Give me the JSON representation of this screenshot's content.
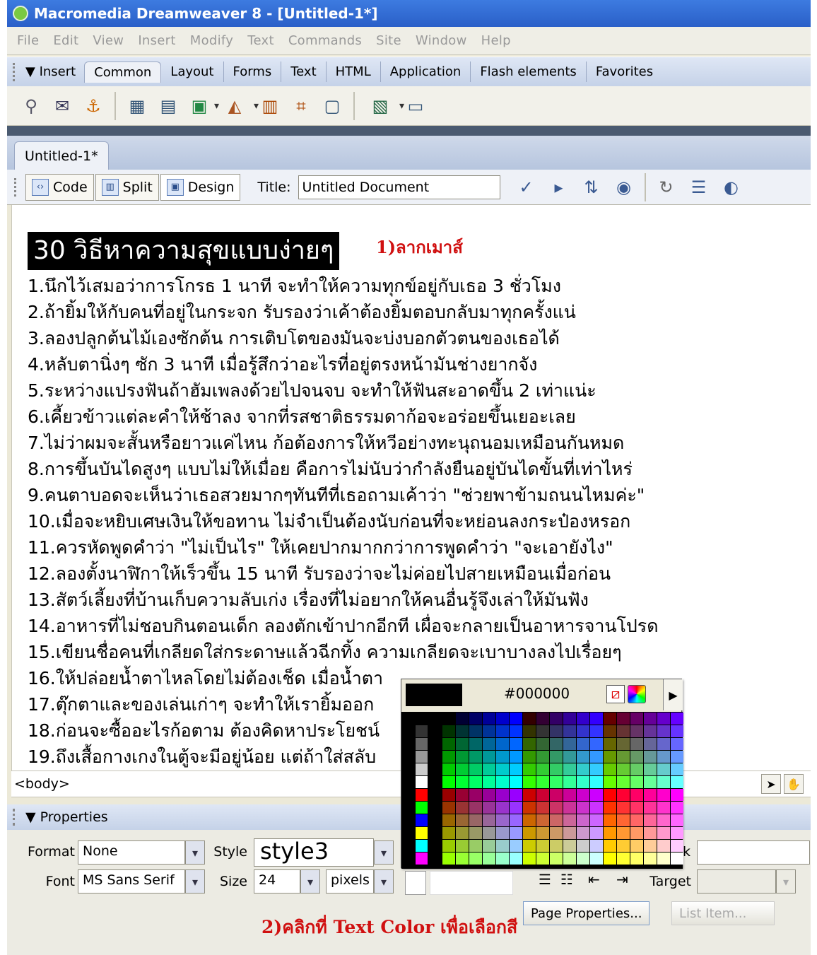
{
  "window": {
    "title": "Macromedia Dreamweaver 8 - [Untitled-1*]"
  },
  "menu": [
    "File",
    "Edit",
    "View",
    "Insert",
    "Modify",
    "Text",
    "Commands",
    "Site",
    "Window",
    "Help"
  ],
  "insert_bar": {
    "label": "Insert",
    "tabs": [
      "Common",
      "Layout",
      "Forms",
      "Text",
      "HTML",
      "Application",
      "Flash elements",
      "Favorites"
    ],
    "active_tab": "Common",
    "icons": [
      "hyperlink-icon",
      "email-link-icon",
      "named-anchor-icon",
      "table-icon",
      "div-icon",
      "image-icon",
      "media-icon",
      "date-icon",
      "server-side-include-icon",
      "comment-icon",
      "template-icon",
      "tag-chooser-icon"
    ]
  },
  "document": {
    "tab_label": "Untitled-1*",
    "view_buttons": {
      "code": "Code",
      "split": "Split",
      "design": "Design"
    },
    "title_label": "Title:",
    "title_value": "Untitled Document",
    "heading": "30 วิธีหาความสุขแบบง่ายๆ",
    "annotation_drag": "1)ลากเมาส์",
    "lines": [
      "1.นึกไว้เสมอว่าการโกรธ 1 นาที จะทำให้ความทุกข์อยู่กับเธอ 3 ชั่วโมง",
      "2.ถ้ายิ้มให้กับคนที่อยู่ในกระจก รับรองว่าเค้าต้องยิ้มตอบกลับมาทุกครั้งแน่",
      "3.ลองปลูกต้นไม้เองซักต้น การเติบโตของมันจะบ่งบอกตัวตนของเธอได้",
      "4.หลับตานิ่งๆ ซัก 3 นาที เมื่อรู้สึกว่าอะไรที่อยู่ตรงหน้ามันช่างยากจัง",
      "5.ระหว่างแปรงฟันถ้าฮัมเพลงด้วยไปจนจบ จะทำให้ฟันสะอาดขึ้น 2 เท่าแน่ะ",
      "6.เคี้ยวข้าวแต่ละคำให้ช้าลง จากที่รสชาติธรรมดาก้อจะอร่อยขึ้นเยอะเลย",
      "7.ไม่ว่าผมจะสั้นหรือยาวแค่ไหน ก้อต้องการให้หวีอย่างทะนุถนอมเหมือนกันหมด",
      "8.การขึ้นบันไดสูงๆ แบบไม่ให้เมื่อย คือการไม่นับว่ากำลังยืนอยู่บันไดขั้นที่เท่าไหร่",
      "9.คนตาบอดจะเห็นว่าเธอสวยมากๆทันทีที่เธอถามเค้าว่า \"ช่วยพาข้ามถนนไหมค่ะ\"",
      "10.เมื่อจะหยิบเศษเงินให้ขอทาน ไม่จำเป็นต้องนับก่อนที่จะหย่อนลงกระป๋องหรอก",
      "11.ควรหัดพูดคำว่า \"ไม่เป็นไร\" ให้เคยปากมากกว่าการพูดคำว่า \"จะเอายังไง\"",
      "12.ลองตั้งนาฬิกาให้เร็วขึ้น 15 นาที รับรองว่าจะไม่ค่อยไปสายเหมือนเมื่อก่อน",
      "13.สัตว์เลี้ยงที่บ้านเก็บความลับเก่ง เรื่องที่ไม่อยากให้คนอื่นรู้จึงเล่าให้มันฟัง",
      "14.อาหารที่ไม่ชอบกินตอนเด็ก ลองตักเข้าปากอีกที เผื่อจะกลายเป็นอาหารจานโปรด",
      "15.เขียนชื่อคนที่เกลียดใส่กระดาษแล้วฉีกทิ้ง ความเกลียดจะเบาบางลงไปเรื่อยๆ",
      "16.ให้ปล่อยน้ำตาไหลโดยไม่ต้องเช็ด เมื่อน้ำตา",
      "17.ตุ๊กตาและของเล่นเก่าๆ จะทำให้เรายิ้มออก",
      "18.ก่อนจะซื้ออะไรก้อตาม ต้องคิดหาประโยชน์",
      "19.ถึงเสื้อกางเกงในตู้จะมีอยู่น้อย แต่ถ้าใส่สลับ"
    ],
    "tag_selector": "<body>"
  },
  "color_picker": {
    "hex": "#000000"
  },
  "properties": {
    "header": "Properties",
    "format_label": "Format",
    "format_value": "None",
    "font_label": "Font",
    "font_value": "MS Sans Serif",
    "style_label": "Style",
    "style_value": "style3",
    "size_label": "Size",
    "size_value": "24",
    "size_unit": "pixels",
    "link_label_fragment": "nk",
    "target_label": "Target",
    "page_properties_button": "Page Properties...",
    "list_item_button": "List Item...",
    "annotation_color": "2)คลิกที่ Text Color เพื่อเลือกสี"
  }
}
